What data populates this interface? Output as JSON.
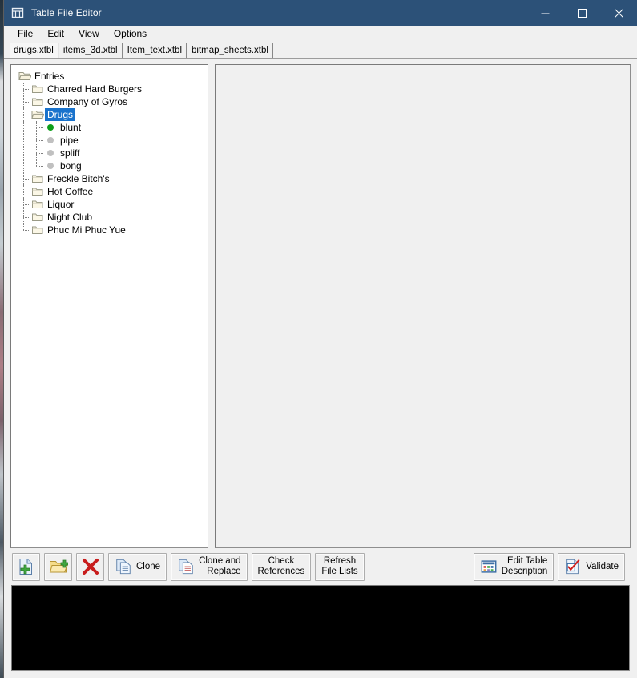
{
  "window": {
    "title": "Table File Editor",
    "icon": "table-app-icon",
    "titlebar_color": "#2c5178",
    "controls": [
      {
        "name": "minimize-button",
        "glyph": "minimize-icon"
      },
      {
        "name": "maximize-button",
        "glyph": "maximize-icon"
      },
      {
        "name": "close-button",
        "glyph": "close-icon"
      }
    ]
  },
  "menubar": {
    "items": [
      {
        "label": "File"
      },
      {
        "label": "Edit"
      },
      {
        "label": "View"
      },
      {
        "label": "Options"
      }
    ]
  },
  "tabs": {
    "active_index": 0,
    "items": [
      {
        "label": "drugs.xtbl"
      },
      {
        "label": "items_3d.xtbl"
      },
      {
        "label": "Item_text.xtbl"
      },
      {
        "label": "bitmap_sheets.xtbl"
      }
    ]
  },
  "tree": {
    "nodes": [
      {
        "label": "Entries",
        "depth": 0,
        "icon": "folder-open-icon",
        "selected": false,
        "last": false
      },
      {
        "label": "Charred Hard Burgers",
        "depth": 1,
        "icon": "folder-closed-icon",
        "selected": false,
        "last": false
      },
      {
        "label": "Company of Gyros",
        "depth": 1,
        "icon": "folder-closed-icon",
        "selected": false,
        "last": false
      },
      {
        "label": "Drugs",
        "depth": 1,
        "icon": "folder-open-icon",
        "selected": true,
        "last": false
      },
      {
        "label": "blunt",
        "depth": 2,
        "icon": "bullet-green-icon",
        "selected": false,
        "last": false,
        "dot_color": "#0d9e19"
      },
      {
        "label": "pipe",
        "depth": 2,
        "icon": "bullet-gray-icon",
        "selected": false,
        "last": false,
        "dot_color": "#c0c0c0"
      },
      {
        "label": "spliff",
        "depth": 2,
        "icon": "bullet-gray-icon",
        "selected": false,
        "last": false,
        "dot_color": "#c0c0c0"
      },
      {
        "label": "bong",
        "depth": 2,
        "icon": "bullet-gray-icon",
        "selected": false,
        "last": true,
        "dot_color": "#c0c0c0"
      },
      {
        "label": "Freckle Bitch's",
        "depth": 1,
        "icon": "folder-closed-icon",
        "selected": false,
        "last": false
      },
      {
        "label": "Hot Coffee",
        "depth": 1,
        "icon": "folder-closed-icon",
        "selected": false,
        "last": false
      },
      {
        "label": "Liquor",
        "depth": 1,
        "icon": "folder-closed-icon",
        "selected": false,
        "last": false
      },
      {
        "label": "Night Club",
        "depth": 1,
        "icon": "folder-closed-icon",
        "selected": false,
        "last": false
      },
      {
        "label": "Phuc Mi Phuc Yue",
        "depth": 1,
        "icon": "folder-closed-icon",
        "selected": false,
        "last": true
      }
    ],
    "selection_color": "#1a73cc"
  },
  "toolbar": {
    "buttons": [
      {
        "name": "new-entry-button",
        "icon": "new-file-icon",
        "label": "",
        "label2": ""
      },
      {
        "name": "open-file-button",
        "icon": "open-folder-icon",
        "label": "",
        "label2": ""
      },
      {
        "name": "delete-entry-button",
        "icon": "delete-x-icon",
        "label": "",
        "label2": ""
      },
      {
        "name": "clone-button",
        "icon": "copy-icon",
        "label": "Clone",
        "label2": ""
      },
      {
        "name": "clone-and-replace-button",
        "icon": "copy-replace-icon",
        "label": "Clone and",
        "label2": "Replace"
      },
      {
        "name": "check-references-button",
        "icon": "",
        "label": "Check",
        "label2": "References"
      },
      {
        "name": "refresh-file-lists-button",
        "icon": "",
        "label": "Refresh",
        "label2": "File Lists"
      }
    ],
    "right_buttons": [
      {
        "name": "edit-table-description-button",
        "icon": "table-grid-icon",
        "label": "Edit Table",
        "label2": "Description"
      },
      {
        "name": "validate-button",
        "icon": "checkbox-red-icon",
        "label": "Validate",
        "label2": ""
      }
    ]
  },
  "console": {
    "text": ""
  }
}
